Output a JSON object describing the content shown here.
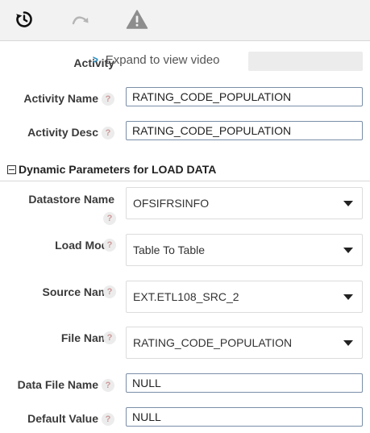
{
  "toolbar": {
    "buttons": [
      {
        "icon": "history-icon"
      },
      {
        "icon": "redo-icon"
      },
      {
        "icon": "warning-icon"
      }
    ]
  },
  "activity": {
    "label": "Activity",
    "expand_text": "Expand to view video"
  },
  "activity_name": {
    "label": "Activity Name",
    "value": "RATING_CODE_POPULATION"
  },
  "activity_desc": {
    "label": "Activity Desc",
    "value": "RATING_CODE_POPULATION"
  },
  "help_glyph": "?",
  "section": {
    "title": "Dynamic Parameters for LOAD DATA",
    "collapse_symbol": "−"
  },
  "params": {
    "datastore_name": {
      "label": "Datastore Name",
      "value": "OFSIFRSINFO"
    },
    "load_mode": {
      "label": "Load Mode",
      "value": "Table To Table"
    },
    "source_name": {
      "label": "Source Name",
      "value": "EXT.ETL108_SRC_2"
    },
    "file_name": {
      "label": "File Name",
      "value": "RATING_CODE_POPULATION"
    },
    "data_file_name": {
      "label": "Data File Name",
      "value": "NULL"
    },
    "default_value": {
      "label": "Default Value",
      "value": "NULL"
    }
  }
}
